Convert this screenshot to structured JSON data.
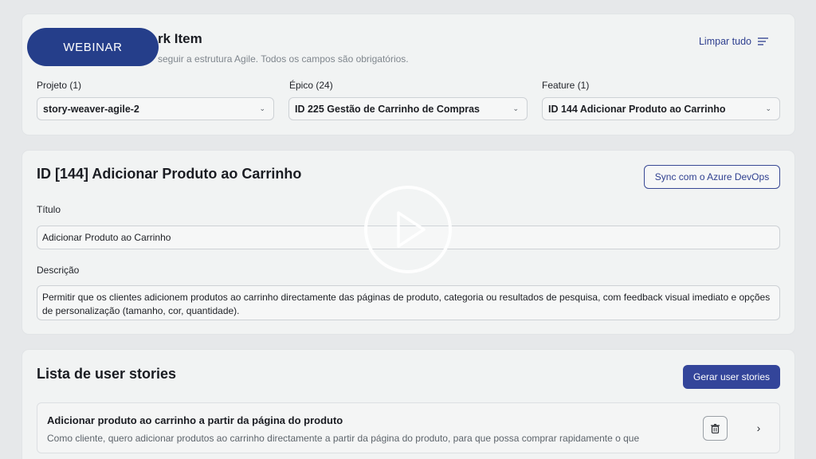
{
  "header": {
    "title_visible": "rk Item",
    "subtitle_visible": "seguir a estrutura Agile. Todos os campos são obrigatórios.",
    "clear_label": "Limpar tudo"
  },
  "filters": [
    {
      "label": "Projeto (1)",
      "value": "story-weaver-agile-2"
    },
    {
      "label": "Épico (24)",
      "value": "ID 225 Gestão de Carrinho de Compras"
    },
    {
      "label": "Feature (1)",
      "value": "ID 144 Adicionar Produto ao Carrinho"
    }
  ],
  "feature": {
    "heading": "ID [144] Adicionar Produto ao Carrinho",
    "sync_label": "Sync com o Azure DevOps",
    "title_label": "Título",
    "title_value": "Adicionar Produto ao Carrinho",
    "desc_label": "Descrição",
    "desc_value": "Permitir que os clientes adicionem produtos ao carrinho directamente das páginas de produto, categoria ou resultados de pesquisa, com feedback visual imediato e opções de personalização (tamanho, cor, quantidade)."
  },
  "stories": {
    "heading": "Lista de user stories",
    "generate_label": "Gerar user stories",
    "items": [
      {
        "title": "Adicionar produto ao carrinho a partir da página do produto",
        "description": "Como cliente, quero adicionar produtos ao carrinho directamente a partir da página do produto, para que possa comprar rapidamente o que"
      }
    ]
  },
  "overlay": {
    "badge_label": "WEBINAR",
    "play_icon": "play-icon"
  },
  "colors": {
    "accent": "#33459a",
    "badge": "#253e8a",
    "background": "#e6e8ea",
    "card": "#f1f3f3"
  }
}
